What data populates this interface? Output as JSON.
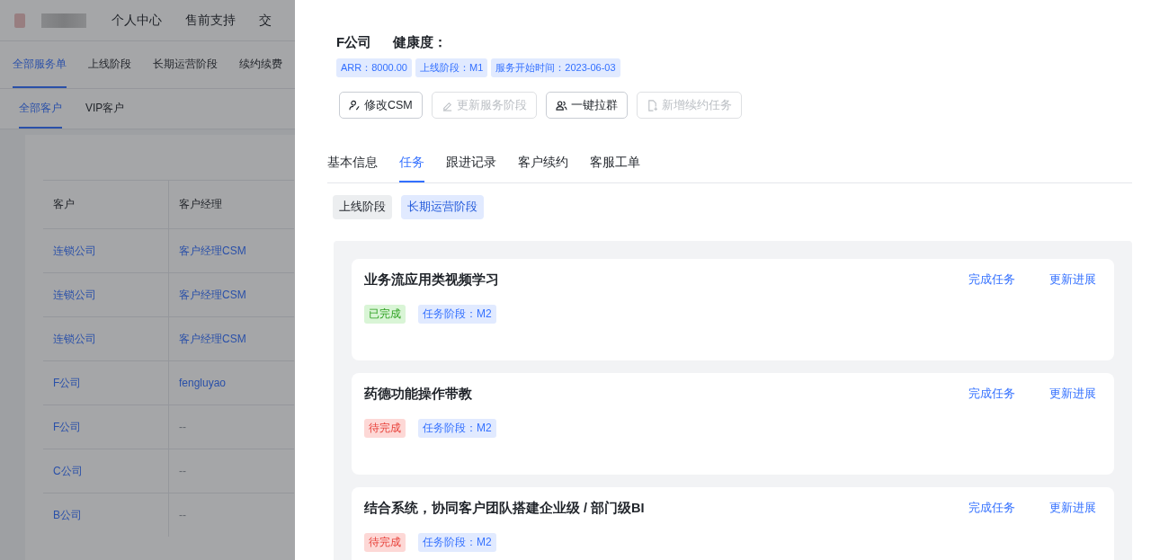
{
  "background_page": {
    "nav": [
      "个人中心",
      "售前支持",
      "交"
    ],
    "tabs": [
      {
        "label": "全部服务单",
        "selected": true
      },
      {
        "label": "上线阶段",
        "selected": false
      },
      {
        "label": "长期运营阶段",
        "selected": false
      },
      {
        "label": "续约续费",
        "selected": false
      }
    ],
    "subtabs": [
      {
        "label": "全部客户",
        "selected": true
      },
      {
        "label": "VIP客户",
        "selected": false
      }
    ],
    "table": {
      "columns": [
        "客户",
        "客户经理"
      ],
      "rows": [
        [
          "连锁公司",
          "客户经理CSM"
        ],
        [
          "连锁公司",
          "客户经理CSM"
        ],
        [
          "连锁公司",
          "客户经理CSM"
        ],
        [
          "F公司",
          "fengluyao"
        ],
        [
          "F公司",
          "--"
        ],
        [
          "C公司",
          "--"
        ],
        [
          "B公司",
          "--"
        ]
      ]
    }
  },
  "drawer": {
    "company": "F公司",
    "health_label": "健康度：",
    "tags": [
      "ARR：8000.00",
      "上线阶段：M1",
      "服务开始时间：2023-06-03"
    ],
    "buttons": [
      {
        "label": "修改CSM",
        "disabled": false
      },
      {
        "label": "更新服务阶段",
        "disabled": true
      },
      {
        "label": "一键拉群",
        "disabled": false
      },
      {
        "label": "新增续约任务",
        "disabled": true
      }
    ],
    "tabs": [
      {
        "label": "基本信息",
        "selected": false
      },
      {
        "label": "任务",
        "selected": true
      },
      {
        "label": "跟进记录",
        "selected": false
      },
      {
        "label": "客户续约",
        "selected": false
      },
      {
        "label": "客服工单",
        "selected": false
      }
    ],
    "stages": [
      {
        "label": "上线阶段",
        "selected": false
      },
      {
        "label": "长期运营阶段",
        "selected": true
      }
    ],
    "tasks": [
      {
        "title": "业务流应用类视频学习",
        "status": "已完成",
        "done": true,
        "stage": "任务阶段：M2",
        "actions": [
          "完成任务",
          "更新进展"
        ]
      },
      {
        "title": "药德功能操作带教",
        "status": "待完成",
        "done": false,
        "stage": "任务阶段：M2",
        "actions": [
          "完成任务",
          "更新进展"
        ]
      },
      {
        "title": "结合系统，协同客户团队搭建企业级 / 部门级BI",
        "status": "待完成",
        "done": false,
        "stage": "任务阶段：M2",
        "actions": [
          "完成任务",
          "更新进展"
        ]
      }
    ]
  }
}
